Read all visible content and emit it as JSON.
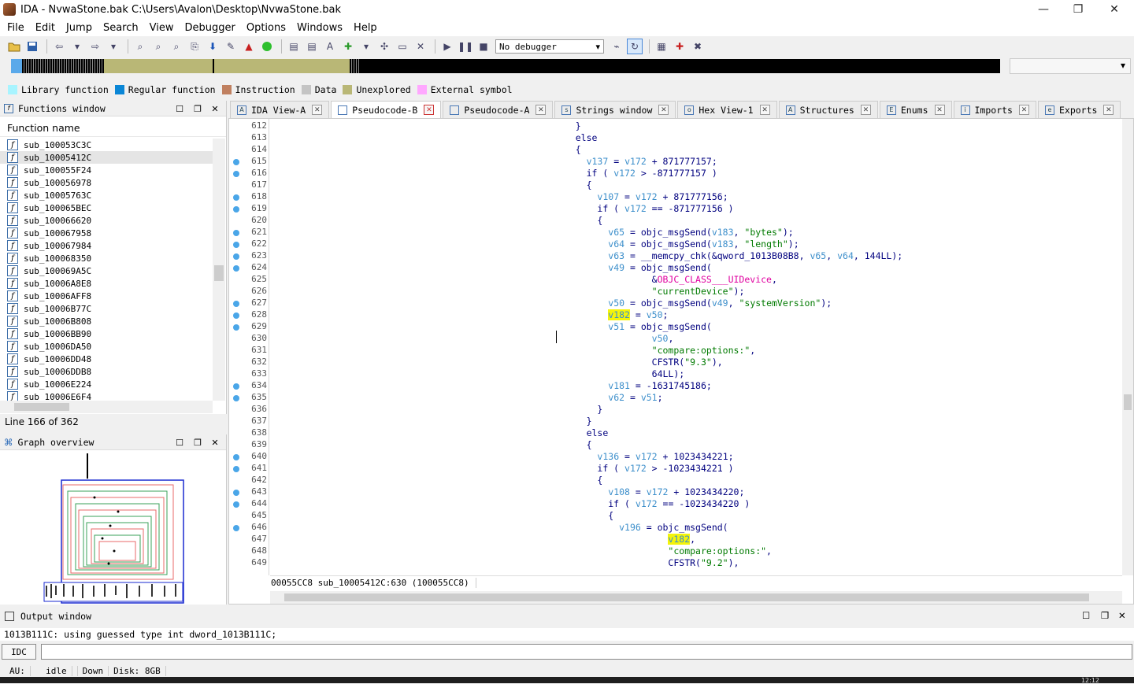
{
  "window": {
    "title": "IDA - NvwaStone.bak C:\\Users\\Avalon\\Desktop\\NvwaStone.bak",
    "min": "—",
    "max": "❐",
    "close": "✕"
  },
  "menu": [
    "File",
    "Edit",
    "Jump",
    "Search",
    "View",
    "Debugger",
    "Options",
    "Windows",
    "Help"
  ],
  "toolbar": {
    "debugger": "No debugger"
  },
  "legend": [
    {
      "label": "Library function",
      "color": "#a8f4ff"
    },
    {
      "label": "Regular function",
      "color": "#0a86d6"
    },
    {
      "label": "Instruction",
      "color": "#c08060"
    },
    {
      "label": "Data",
      "color": "#c4c4c4"
    },
    {
      "label": "Unexplored",
      "color": "#b9b776"
    },
    {
      "label": "External symbol",
      "color": "#ffa8ff"
    }
  ],
  "functions_window": {
    "title": "Functions window",
    "column": "Function name",
    "selected": 1,
    "items": [
      "sub_100053C3C",
      "sub_10005412C",
      "sub_100055F24",
      "sub_100056978",
      "sub_10005763C",
      "sub_100065BEC",
      "sub_100066620",
      "sub_100067958",
      "sub_100067984",
      "sub_100068350",
      "sub_100069A5C",
      "sub_10006A8E8",
      "sub_10006AFF8",
      "sub_10006B77C",
      "sub_10006B808",
      "sub_10006BB90",
      "sub_10006DA50",
      "sub_10006DD48",
      "sub_10006DDB8",
      "sub_10006E224",
      "sub_10006E6F4"
    ],
    "line_info": "Line 166 of 362"
  },
  "graph_overview": {
    "title": "Graph overview"
  },
  "tabs": [
    {
      "label": "IDA View-A",
      "icon": "A",
      "active": false
    },
    {
      "label": "Pseudocode-B",
      "icon": "",
      "active": true
    },
    {
      "label": "Pseudocode-A",
      "icon": "",
      "active": false
    },
    {
      "label": "Strings window",
      "icon": "s",
      "active": false
    },
    {
      "label": "Hex View-1",
      "icon": "o",
      "active": false
    },
    {
      "label": "Structures",
      "icon": "A",
      "active": false
    },
    {
      "label": "Enums",
      "icon": "E",
      "active": false
    },
    {
      "label": "Imports",
      "icon": "i",
      "active": false
    },
    {
      "label": "Exports",
      "icon": "e",
      "active": false
    }
  ],
  "code": [
    {
      "n": 612,
      "dot": false,
      "t": "                                                        }"
    },
    {
      "n": 613,
      "dot": false,
      "t": "                                                        else"
    },
    {
      "n": 614,
      "dot": false,
      "t": "                                                        {"
    },
    {
      "n": 615,
      "dot": true,
      "t": "                                                          v137 = v172 + 871777157;"
    },
    {
      "n": 616,
      "dot": true,
      "t": "                                                          if ( v172 > -871777157 )"
    },
    {
      "n": 617,
      "dot": false,
      "t": "                                                          {"
    },
    {
      "n": 618,
      "dot": true,
      "t": "                                                            v107 = v172 + 871777156;"
    },
    {
      "n": 619,
      "dot": true,
      "t": "                                                            if ( v172 == -871777156 )"
    },
    {
      "n": 620,
      "dot": false,
      "t": "                                                            {"
    },
    {
      "n": 621,
      "dot": true,
      "t": "                                                              v65 = objc_msgSend(v183, \"bytes\");"
    },
    {
      "n": 622,
      "dot": true,
      "t": "                                                              v64 = objc_msgSend(v183, \"length\");"
    },
    {
      "n": 623,
      "dot": true,
      "t": "                                                              v63 = __memcpy_chk(&qword_1013B08B8, v65, v64, 144LL);"
    },
    {
      "n": 624,
      "dot": true,
      "t": "                                                              v49 = objc_msgSend("
    },
    {
      "n": 625,
      "dot": false,
      "t": "                                                                      &OBJC_CLASS___UIDevice,"
    },
    {
      "n": 626,
      "dot": false,
      "t": "                                                                      \"currentDevice\");"
    },
    {
      "n": 627,
      "dot": true,
      "t": "                                                              v50 = objc_msgSend(v49, \"systemVersion\");"
    },
    {
      "n": 628,
      "dot": true,
      "t": "                                                              v182 = v50;"
    },
    {
      "n": 629,
      "dot": true,
      "t": "                                                              v51 = objc_msgSend("
    },
    {
      "n": 630,
      "dot": false,
      "t": "                                                                      v50,"
    },
    {
      "n": 631,
      "dot": false,
      "t": "                                                                      \"compare:options:\","
    },
    {
      "n": 632,
      "dot": false,
      "t": "                                                                      CFSTR(\"9.3\"),"
    },
    {
      "n": 633,
      "dot": false,
      "t": "                                                                      64LL);"
    },
    {
      "n": 634,
      "dot": true,
      "t": "                                                              v181 = -1631745186;"
    },
    {
      "n": 635,
      "dot": true,
      "t": "                                                              v62 = v51;"
    },
    {
      "n": 636,
      "dot": false,
      "t": "                                                            }"
    },
    {
      "n": 637,
      "dot": false,
      "t": "                                                          }"
    },
    {
      "n": 638,
      "dot": false,
      "t": "                                                          else"
    },
    {
      "n": 639,
      "dot": false,
      "t": "                                                          {"
    },
    {
      "n": 640,
      "dot": true,
      "t": "                                                            v136 = v172 + 1023434221;"
    },
    {
      "n": 641,
      "dot": true,
      "t": "                                                            if ( v172 > -1023434221 )"
    },
    {
      "n": 642,
      "dot": false,
      "t": "                                                            {"
    },
    {
      "n": 643,
      "dot": true,
      "t": "                                                              v108 = v172 + 1023434220;"
    },
    {
      "n": 644,
      "dot": true,
      "t": "                                                              if ( v172 == -1023434220 )"
    },
    {
      "n": 645,
      "dot": false,
      "t": "                                                              {"
    },
    {
      "n": 646,
      "dot": true,
      "t": "                                                                v196 = objc_msgSend("
    },
    {
      "n": 647,
      "dot": false,
      "t": "                                                                         v182,"
    },
    {
      "n": 648,
      "dot": false,
      "t": "                                                                         \"compare:options:\","
    },
    {
      "n": 649,
      "dot": false,
      "t": "                                                                         CFSTR(\"9.2\"),"
    }
  ],
  "code_status": "00055CC8 sub_10005412C:630 (100055CC8)",
  "output": {
    "title": "Output window",
    "line": "1013B111C: using guessed type int dword_1013B111C;",
    "idc": "IDC"
  },
  "statusbar": {
    "au": "AU:",
    "state": "idle",
    "dir": "Down",
    "disk": "Disk: 8GB"
  },
  "taskbar": {
    "clock": "12:12"
  }
}
